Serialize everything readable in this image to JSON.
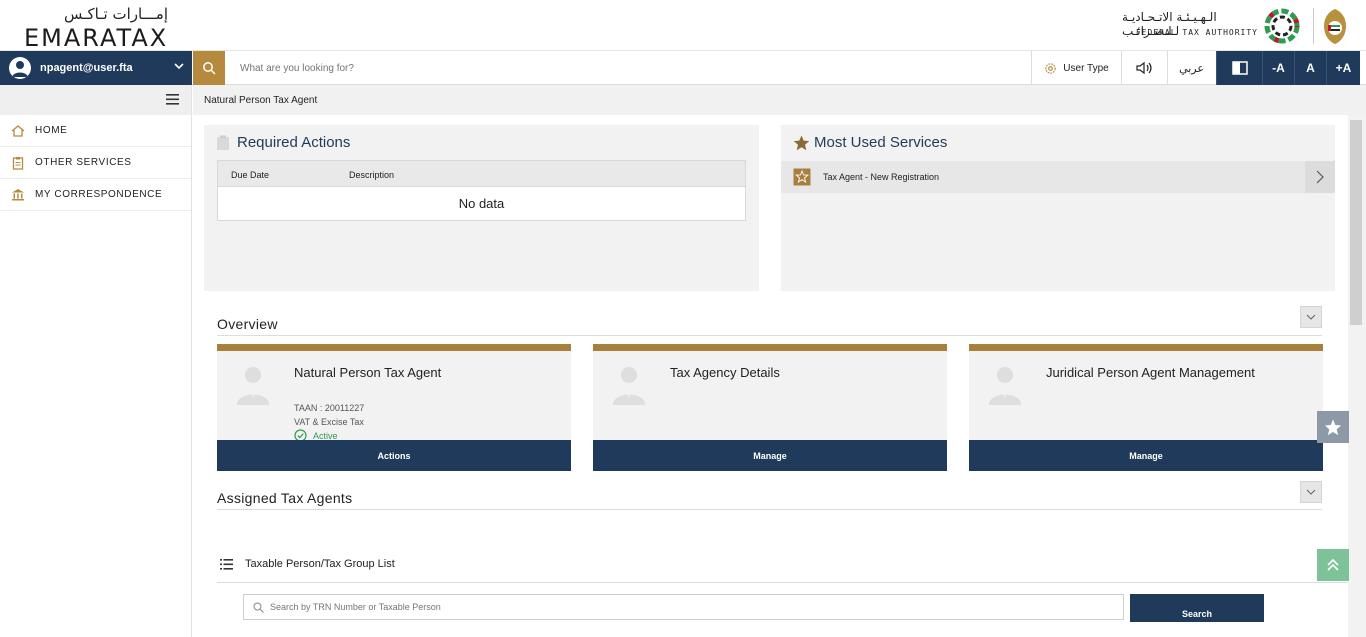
{
  "brand": {
    "logo_ar": "إمـــارات تـاكـس",
    "logo_en": "EMARATAX",
    "fta_ar": "الـهـيـئـة الاتـحـاديـة لـلـضـرائـب",
    "fta_en": "FEDERAL TAX AUTHORITY"
  },
  "user": {
    "email": "npagent@user.fta"
  },
  "search": {
    "placeholder": "What are you looking for?"
  },
  "toolbar": {
    "user_type_label": "User Type",
    "arabic_label": "عربي",
    "font_decrease": "-A",
    "font_reset": "A",
    "font_increase": "+A"
  },
  "sidebar": {
    "items": [
      {
        "label": "HOME",
        "icon": "home-icon"
      },
      {
        "label": "OTHER SERVICES",
        "icon": "clipboard-icon"
      },
      {
        "label": "MY CORRESPONDENCE",
        "icon": "building-icon"
      }
    ]
  },
  "breadcrumb": {
    "current": "Natural Person Tax Agent"
  },
  "required_actions": {
    "title": "Required Actions",
    "columns": [
      "Due Date",
      "Description"
    ],
    "empty_text": "No data"
  },
  "most_used": {
    "title": "Most Used Services",
    "items": [
      {
        "label": "Tax Agent - New Registration"
      }
    ]
  },
  "overview": {
    "title": "Overview",
    "cards": [
      {
        "title": "Natural Person Tax Agent",
        "taan": "TAAN : 20011227",
        "tax_type": "VAT & Excise Tax",
        "status": "Active",
        "button": "Actions"
      },
      {
        "title": "Tax Agency Details",
        "button": "Manage"
      },
      {
        "title": "Juridical Person Agent Management",
        "button": "Manage"
      }
    ]
  },
  "assigned": {
    "title": "Assigned Tax Agents",
    "list_title": "Taxable Person/Tax Group List",
    "search_placeholder": "Search by TRN Number or Taxable Person",
    "search_button": "Search"
  },
  "colors": {
    "navy": "#1f3a5a",
    "gold": "#b58a3f",
    "card_accent": "#a97f3e",
    "status_active": "#2e9b4e"
  }
}
